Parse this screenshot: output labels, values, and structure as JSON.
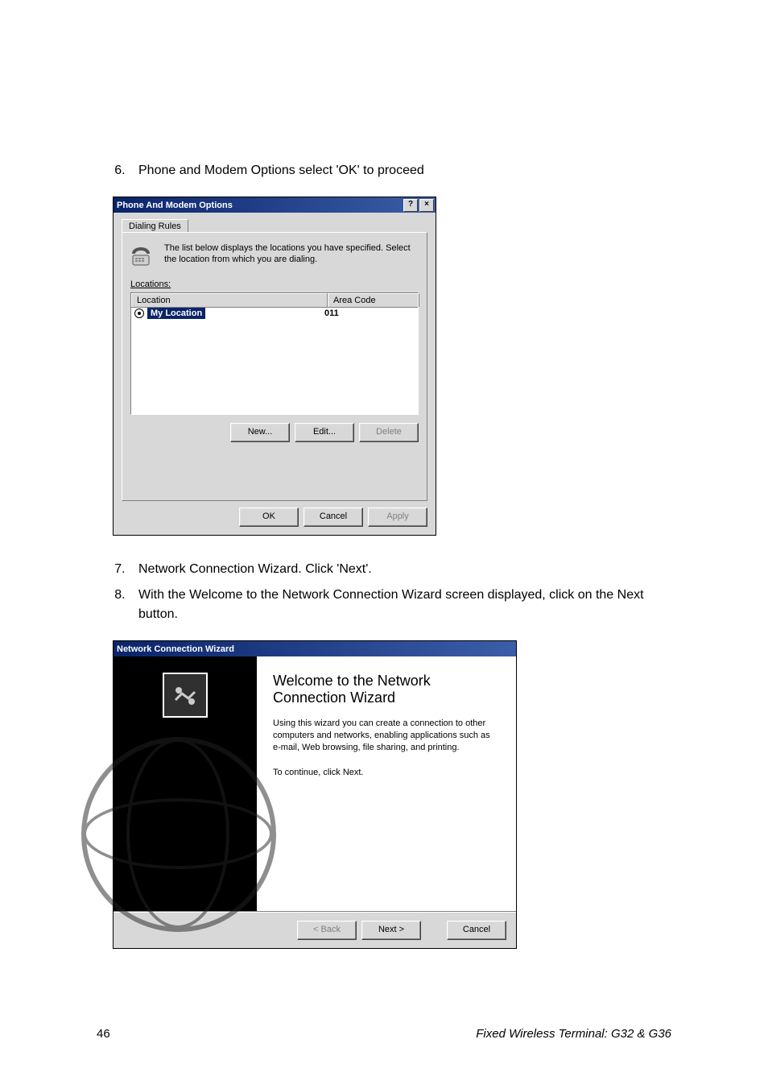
{
  "step6": {
    "num": "6.",
    "text": "Phone and Modem Options select 'OK' to proceed"
  },
  "step7": {
    "num": "7.",
    "text": "Network Connection Wizard. Click 'Next'."
  },
  "step8": {
    "num": "8.",
    "text": "With the Welcome to the Network Connection Wizard screen displayed, click on the Next button."
  },
  "dlg1": {
    "title": "Phone And Modem Options",
    "help_btn": "?",
    "close_btn": "×",
    "tab": "Dialing Rules",
    "desc": "The list below displays the locations you have specified. Select the location from which you are dialing.",
    "loc_label_u": "L",
    "loc_label_rest": "ocations:",
    "col_location": "Location",
    "col_areacode": "Area Code",
    "row": {
      "name": "My Location",
      "areacode": "011"
    },
    "btn_new": "New...",
    "btn_edit": "Edit...",
    "btn_delete": "Delete",
    "btn_ok": "OK",
    "btn_cancel": "Cancel",
    "btn_apply": "Apply"
  },
  "dlg2": {
    "title": "Network Connection Wizard",
    "heading": "Welcome to the Network Connection Wizard",
    "para": "Using this wizard you can create a connection to other computers and networks, enabling applications such as e-mail, Web browsing, file sharing, and printing.",
    "continue": "To continue, click Next.",
    "btn_back": "< Back",
    "btn_next": "Next >",
    "btn_cancel": "Cancel"
  },
  "footer": {
    "page": "46",
    "book": "Fixed Wireless Terminal: G32 & G36"
  }
}
